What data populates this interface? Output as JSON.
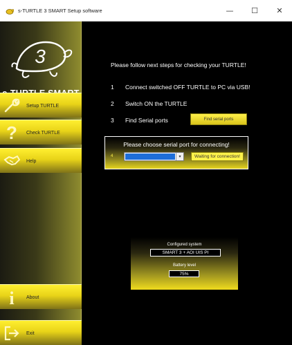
{
  "window": {
    "title": "s-TURTLE 3 SMART Setup software",
    "buttons": {
      "minimize": "—",
      "maximize": "☐",
      "close": "✕"
    }
  },
  "sidebar": {
    "logo_number": "3",
    "brand": "s-TURTLE SMART",
    "items": [
      {
        "label": "Setup TURTLE",
        "icon": "wrench-icon"
      },
      {
        "label": "Check TURTLE",
        "icon": "question-icon"
      },
      {
        "label": "Help",
        "icon": "handshake-icon"
      },
      {
        "label": "About",
        "icon": "info-icon"
      },
      {
        "label": "Exit",
        "icon": "exit-icon"
      }
    ]
  },
  "main": {
    "headline": "Please follow next steps for checking your TURTLE!",
    "steps": [
      {
        "num": "1",
        "text": "Connect switched OFF TURTLE to PC via USB!"
      },
      {
        "num": "2",
        "text": "Switch ON the TURTLE"
      },
      {
        "num": "3",
        "text": "Find Serial ports"
      }
    ],
    "find_button": "Find serial ports",
    "port_panel": {
      "title": "Please choose serial port for connecting!",
      "num": "4",
      "select_value": "",
      "status": "Waiting for connection!"
    },
    "system_panel": {
      "configured_label": "Configured system",
      "configured_value": "SMART 3 + AOI UIS PI",
      "battery_label": "Battery level",
      "battery_value": "75%"
    }
  },
  "colors": {
    "accent": "#FFEF30",
    "background": "#000000",
    "selection": "#1E6ED8"
  }
}
